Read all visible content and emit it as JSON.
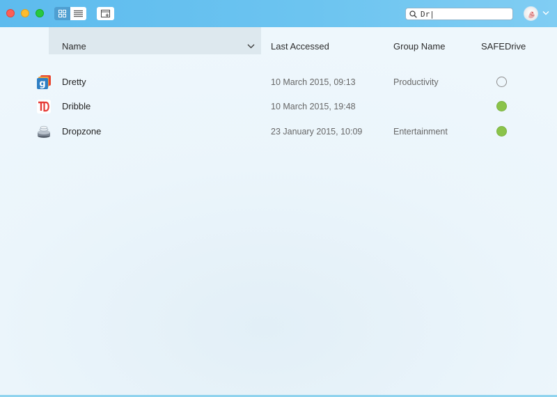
{
  "window": {
    "buttons": [
      "close",
      "minimize",
      "maximize"
    ]
  },
  "toolbar": {
    "view_modes": [
      {
        "name": "grid-view",
        "icon": "grid-icon",
        "selected": true
      },
      {
        "name": "list-view",
        "icon": "list-icon",
        "selected": false
      }
    ],
    "new_window_icon": "new-window-icon",
    "search": {
      "value": "Dr|",
      "icon": "search-icon"
    },
    "account": {
      "icon": "avatar",
      "menu_icon": "chevron-down-icon"
    }
  },
  "table": {
    "columns": {
      "name": "Name",
      "last_accessed": "Last Accessed",
      "group_name": "Group Name",
      "safedrive": "SAFEDrive"
    },
    "sort_column": "Name",
    "rows": [
      {
        "name": "Dretty",
        "last_accessed": "10 March 2015, 09:13",
        "group": "Productivity",
        "safedrive": false,
        "icon": "dretty-app-icon"
      },
      {
        "name": "Dribble",
        "last_accessed": "10 March 2015, 19:48",
        "group": "",
        "safedrive": true,
        "icon": "dribble-app-icon"
      },
      {
        "name": "Dropzone",
        "last_accessed": "23 January 2015, 10:09",
        "group": "Entertainment",
        "safedrive": true,
        "icon": "dropzone-app-icon"
      }
    ]
  },
  "colors": {
    "titlebar": "#6cc4f0",
    "safedrive_on": "#8bc34a",
    "safedrive_off": "#8c8c8c",
    "sorted_column": "#dde8ee"
  }
}
